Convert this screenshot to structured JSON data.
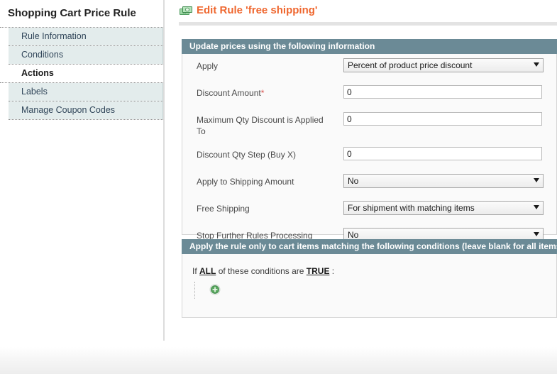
{
  "sidebar": {
    "title": "Shopping Cart Price Rule",
    "items": [
      {
        "label": "Rule Information",
        "active": false
      },
      {
        "label": "Conditions",
        "active": false
      },
      {
        "label": "Actions",
        "active": true
      },
      {
        "label": "Labels",
        "active": false
      },
      {
        "label": "Manage Coupon Codes",
        "active": false
      }
    ]
  },
  "header": {
    "title": "Edit Rule 'free shipping'",
    "icon": "money-icon",
    "title_color": "#ef672f"
  },
  "actions_panel": {
    "heading": "Update prices using the following information",
    "fields": [
      {
        "label": "Apply",
        "required": false,
        "type": "select",
        "value": "Percent of product price discount"
      },
      {
        "label": "Discount Amount",
        "required": true,
        "type": "text",
        "value": "0"
      },
      {
        "label": "Maximum Qty Discount is Applied To",
        "required": false,
        "type": "text",
        "value": "0"
      },
      {
        "label": "Discount Qty Step (Buy X)",
        "required": false,
        "type": "text",
        "value": "0"
      },
      {
        "label": "Apply to Shipping Amount",
        "required": false,
        "type": "select",
        "value": "No"
      },
      {
        "label": "Free Shipping",
        "required": false,
        "type": "select",
        "value": "For shipment with matching items"
      },
      {
        "label": "Stop Further Rules Processing",
        "required": false,
        "type": "select",
        "value": "No"
      }
    ]
  },
  "conditions_panel": {
    "heading": "Apply the rule only to cart items matching the following conditions (leave blank for all items)",
    "prefix": "If",
    "aggregator": "ALL",
    "middle": "of these conditions are",
    "value": "TRUE",
    "suffix": ":",
    "add_icon": "add-circle-icon"
  },
  "required_marker": "*"
}
